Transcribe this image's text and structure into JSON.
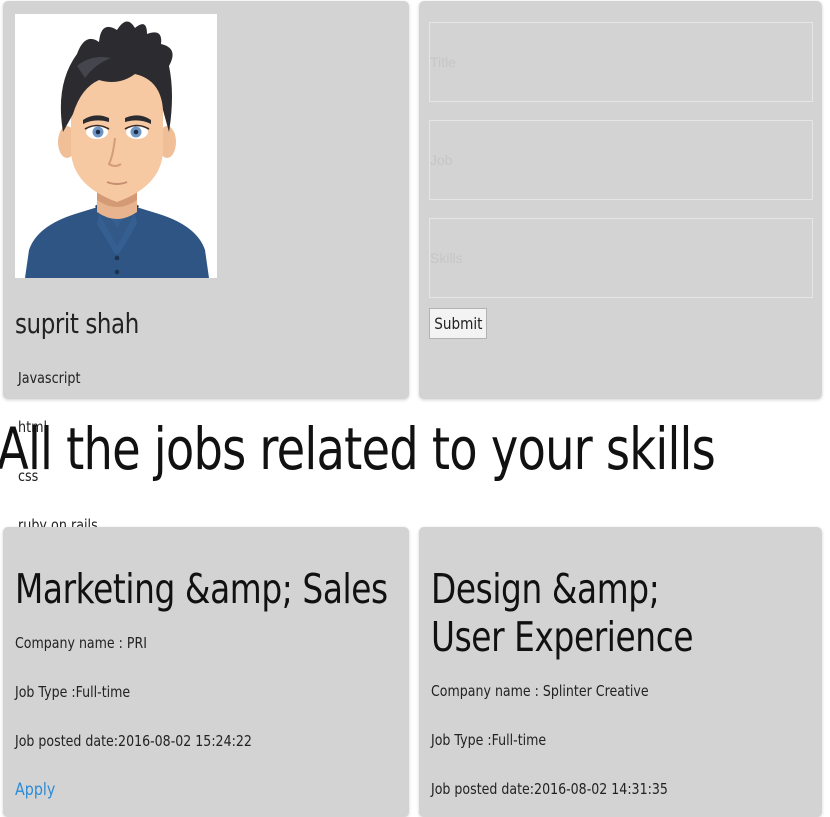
{
  "profile": {
    "name": "suprit shah",
    "skills": [
      "Javascript",
      "html",
      "css",
      "ruby on rails"
    ]
  },
  "form": {
    "fields": [
      {
        "placeholder": "Title"
      },
      {
        "placeholder": "Job"
      },
      {
        "placeholder": "Skills"
      }
    ],
    "submit_label": "Submit"
  },
  "jobs_section": {
    "heading": "All the jobs related to your skills"
  },
  "jobs": [
    {
      "title": "Marketing &amp; Sales",
      "company": "Company name : PRI",
      "type": "Job Type :Full-time",
      "posted": "Job posted date:2016-08-02 15:24:22",
      "apply_label": "Apply"
    },
    {
      "title": "Design &amp; User Experience",
      "company": "Company name : Splinter Creative",
      "type": "Job Type :Full-time",
      "posted": "Job posted date:2016-08-02 14:31:35"
    }
  ],
  "colors": {
    "card_bg": "#d3d3d3",
    "link": "#2a8bd8",
    "avatar_shirt": "#2f5585",
    "avatar_hair": "#2b2b30"
  }
}
